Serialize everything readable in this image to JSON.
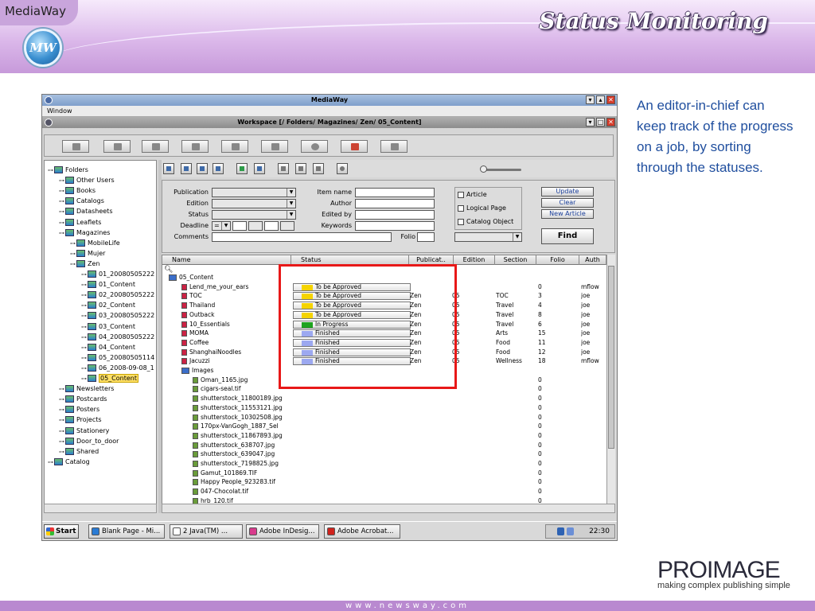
{
  "slide": {
    "brand": "MediaWay",
    "logo_text": "MW",
    "title": "Status Monitoring",
    "description": "An editor-in-chief can keep track of the progress on a job, by sorting through the statuses.",
    "footer": "www.newsway.com",
    "company_logo": "PROIMAGE",
    "company_tagline": "making complex publishing simple"
  },
  "app": {
    "window_title": "MediaWay",
    "menu": [
      "Window"
    ],
    "workspace_title": "Workspace [/ Folders/ Magazines/ Zen/ 05_Content]",
    "tree": {
      "root": "Folders",
      "nodes": [
        {
          "label": "Folders",
          "depth": 0,
          "selected": false
        },
        {
          "label": "Other Users",
          "depth": 1,
          "selected": false
        },
        {
          "label": "Books",
          "depth": 1,
          "selected": false
        },
        {
          "label": "Catalogs",
          "depth": 1,
          "selected": false
        },
        {
          "label": "Datasheets",
          "depth": 1,
          "selected": false
        },
        {
          "label": "Leaflets",
          "depth": 1,
          "selected": false
        },
        {
          "label": "Magazines",
          "depth": 1,
          "selected": false
        },
        {
          "label": "MobileLife",
          "depth": 2,
          "selected": false
        },
        {
          "label": "Mujer",
          "depth": 2,
          "selected": false
        },
        {
          "label": "Zen",
          "depth": 2,
          "selected": false
        },
        {
          "label": "01_20080505222",
          "depth": 3,
          "selected": false
        },
        {
          "label": "01_Content",
          "depth": 3,
          "selected": false
        },
        {
          "label": "02_20080505222",
          "depth": 3,
          "selected": false
        },
        {
          "label": "02_Content",
          "depth": 3,
          "selected": false
        },
        {
          "label": "03_20080505222",
          "depth": 3,
          "selected": false
        },
        {
          "label": "03_Content",
          "depth": 3,
          "selected": false
        },
        {
          "label": "04_20080505222",
          "depth": 3,
          "selected": false
        },
        {
          "label": "04_Content",
          "depth": 3,
          "selected": false
        },
        {
          "label": "05_20080505114",
          "depth": 3,
          "selected": false
        },
        {
          "label": "06_2008-09-08_1",
          "depth": 3,
          "selected": false
        },
        {
          "label": "05_Content",
          "depth": 3,
          "selected": true
        },
        {
          "label": "Newsletters",
          "depth": 1,
          "selected": false
        },
        {
          "label": "Postcards",
          "depth": 1,
          "selected": false
        },
        {
          "label": "Posters",
          "depth": 1,
          "selected": false
        },
        {
          "label": "Projects",
          "depth": 1,
          "selected": false
        },
        {
          "label": "Stationery",
          "depth": 1,
          "selected": false
        },
        {
          "label": "Door_to_door",
          "depth": 1,
          "selected": false
        },
        {
          "label": "Shared",
          "depth": 1,
          "selected": false
        },
        {
          "label": "Catalog",
          "depth": 0,
          "selected": false
        }
      ]
    },
    "search": {
      "publication_label": "Publication",
      "edition_label": "Edition",
      "status_label": "Status",
      "deadline_label": "Deadline",
      "deadline_op": "=",
      "comments_label": "Comments",
      "item_name_label": "Item name",
      "author_label": "Author",
      "edited_by_label": "Edited by",
      "keywords_label": "Keywords",
      "folio_label": "Folio",
      "article_label": "Article",
      "logical_page_label": "Logical Page",
      "catalog_object_label": "Catalog Object",
      "update_label": "Update",
      "clear_label": "Clear",
      "new_article_label": "New Article",
      "find_label": "Find"
    },
    "grid": {
      "columns": [
        "Name",
        "Status",
        "Publicat..",
        "Edition",
        "Section",
        "Folio",
        "Auth"
      ],
      "rows": [
        {
          "name": "05_Content",
          "kind": "folder",
          "status": "",
          "status_color": "",
          "pub": "",
          "edition": "",
          "section": "",
          "folio": "",
          "author": ""
        },
        {
          "name": "Lend_me_your_ears",
          "kind": "article",
          "status": "To be Approved",
          "status_color": "#f5d400",
          "pub": "",
          "edition": "",
          "section": "",
          "folio": "0",
          "author": "mflow"
        },
        {
          "name": "TOC",
          "kind": "article",
          "status": "To be Approved",
          "status_color": "#f5d400",
          "pub": "Zen",
          "edition": "05",
          "section": "TOC",
          "folio": "3",
          "author": "joe"
        },
        {
          "name": "Thailand",
          "kind": "article",
          "status": "To be Approved",
          "status_color": "#f5d400",
          "pub": "Zen",
          "edition": "05",
          "section": "Travel",
          "folio": "4",
          "author": "joe"
        },
        {
          "name": "Outback",
          "kind": "article",
          "status": "To be Approved",
          "status_color": "#f5d400",
          "pub": "Zen",
          "edition": "05",
          "section": "Travel",
          "folio": "8",
          "author": "joe"
        },
        {
          "name": "10_Essentials",
          "kind": "article",
          "status": "In Progress",
          "status_color": "#1fa31f",
          "pub": "Zen",
          "edition": "05",
          "section": "Travel",
          "folio": "6",
          "author": "joe"
        },
        {
          "name": "MOMA",
          "kind": "article",
          "status": "Finished",
          "status_color": "#9ca8f0",
          "pub": "Zen",
          "edition": "05",
          "section": "Arts",
          "folio": "15",
          "author": "joe"
        },
        {
          "name": "Coffee",
          "kind": "article",
          "status": "Finished",
          "status_color": "#9ca8f0",
          "pub": "Zen",
          "edition": "05",
          "section": "Food",
          "folio": "11",
          "author": "joe"
        },
        {
          "name": "ShanghaiNoodles",
          "kind": "article",
          "status": "Finished",
          "status_color": "#9ca8f0",
          "pub": "Zen",
          "edition": "05",
          "section": "Food",
          "folio": "12",
          "author": "joe"
        },
        {
          "name": "Jacuzzi",
          "kind": "article",
          "status": "Finished",
          "status_color": "#9ca8f0",
          "pub": "Zen",
          "edition": "05",
          "section": "Wellness",
          "folio": "18",
          "author": "mflow"
        },
        {
          "name": "Images",
          "kind": "folder",
          "status": "",
          "status_color": "",
          "pub": "",
          "edition": "",
          "section": "",
          "folio": "",
          "author": ""
        },
        {
          "name": "Oman_1165.jpg",
          "kind": "image",
          "status": "",
          "status_color": "",
          "pub": "",
          "edition": "",
          "section": "",
          "folio": "0",
          "author": ""
        },
        {
          "name": "cigars-seal.tif",
          "kind": "image",
          "status": "",
          "status_color": "",
          "pub": "",
          "edition": "",
          "section": "",
          "folio": "0",
          "author": ""
        },
        {
          "name": "shutterstock_11800189.jpg",
          "kind": "image",
          "status": "",
          "status_color": "",
          "pub": "",
          "edition": "",
          "section": "",
          "folio": "0",
          "author": ""
        },
        {
          "name": "shutterstock_11553121.jpg",
          "kind": "image",
          "status": "",
          "status_color": "",
          "pub": "",
          "edition": "",
          "section": "",
          "folio": "0",
          "author": ""
        },
        {
          "name": "shutterstock_10302508.jpg",
          "kind": "image",
          "status": "",
          "status_color": "",
          "pub": "",
          "edition": "",
          "section": "",
          "folio": "0",
          "author": ""
        },
        {
          "name": "170px-VanGogh_1887_Sel",
          "kind": "image",
          "status": "",
          "status_color": "",
          "pub": "",
          "edition": "",
          "section": "",
          "folio": "0",
          "author": ""
        },
        {
          "name": "shutterstock_11867893.jpg",
          "kind": "image",
          "status": "",
          "status_color": "",
          "pub": "",
          "edition": "",
          "section": "",
          "folio": "0",
          "author": ""
        },
        {
          "name": "shutterstock_638707.jpg",
          "kind": "image",
          "status": "",
          "status_color": "",
          "pub": "",
          "edition": "",
          "section": "",
          "folio": "0",
          "author": ""
        },
        {
          "name": "shutterstock_639047.jpg",
          "kind": "image",
          "status": "",
          "status_color": "",
          "pub": "",
          "edition": "",
          "section": "",
          "folio": "0",
          "author": ""
        },
        {
          "name": "shutterstock_7198825.jpg",
          "kind": "image",
          "status": "",
          "status_color": "",
          "pub": "",
          "edition": "",
          "section": "",
          "folio": "0",
          "author": ""
        },
        {
          "name": "Gamut_101869.TIF",
          "kind": "image",
          "status": "",
          "status_color": "",
          "pub": "",
          "edition": "",
          "section": "",
          "folio": "0",
          "author": ""
        },
        {
          "name": "Happy People_923283.tif",
          "kind": "image",
          "status": "",
          "status_color": "",
          "pub": "",
          "edition": "",
          "section": "",
          "folio": "0",
          "author": ""
        },
        {
          "name": "047-Chocolat.tif",
          "kind": "image",
          "status": "",
          "status_color": "",
          "pub": "",
          "edition": "",
          "section": "",
          "folio": "0",
          "author": ""
        },
        {
          "name": "hrb_120.tif",
          "kind": "image",
          "status": "",
          "status_color": "",
          "pub": "",
          "edition": "",
          "section": "",
          "folio": "0",
          "author": ""
        }
      ]
    },
    "taskbar": {
      "start_label": "Start",
      "tasks": [
        {
          "label": "Blank Page - Mi...",
          "icon": "browser-icon",
          "color": "#2a7bd4"
        },
        {
          "label": "2 Java(TM) ...",
          "icon": "java-window-icon",
          "color": "#ffffff"
        },
        {
          "label": "Adobe InDesig...",
          "icon": "indesign-icon",
          "color": "#d83b8c"
        },
        {
          "label": "Adobe Acrobat...",
          "icon": "acrobat-icon",
          "color": "#d0221c"
        }
      ],
      "clock": "22:30"
    }
  }
}
